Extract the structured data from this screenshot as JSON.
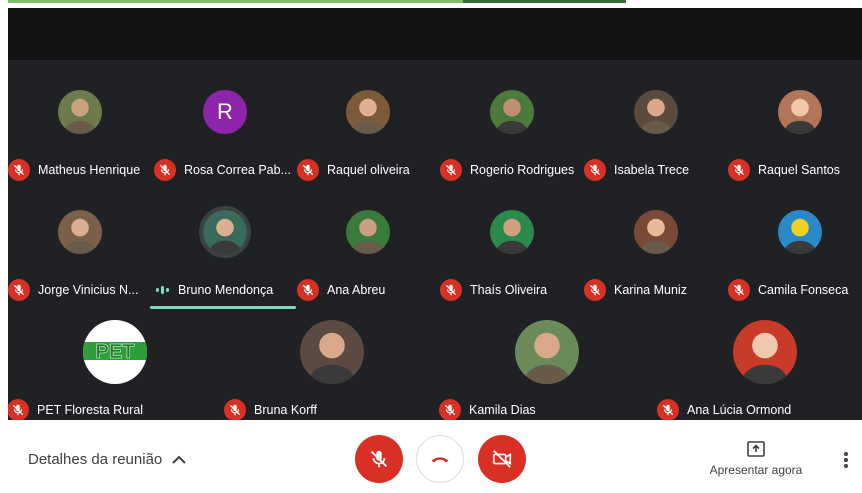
{
  "participants": [
    {
      "name": "Matheus Henrique",
      "avatar": "photo",
      "muted": true
    },
    {
      "name": "Rosa Correa Pab...",
      "avatar": "letter",
      "letter": "R",
      "avatar_color": "#8e24aa",
      "muted": true
    },
    {
      "name": "Raquel oliveira",
      "avatar": "photo",
      "muted": true
    },
    {
      "name": "Rogerio Rodrigues",
      "avatar": "photo",
      "muted": true
    },
    {
      "name": "Isabela Trece",
      "avatar": "photo",
      "muted": true
    },
    {
      "name": "Raquel Santos",
      "avatar": "photo",
      "muted": true
    },
    {
      "name": "Jorge Vinicius N...",
      "avatar": "photo",
      "muted": true
    },
    {
      "name": "Bruno Mendonça",
      "avatar": "photo",
      "muted": false,
      "speaking": true
    },
    {
      "name": "Ana Abreu",
      "avatar": "photo",
      "muted": true
    },
    {
      "name": "Thaís Oliveira",
      "avatar": "photo",
      "muted": true
    },
    {
      "name": "Karina Muniz",
      "avatar": "photo",
      "muted": true
    },
    {
      "name": "Camila Fonseca",
      "avatar": "photo",
      "muted": true
    },
    {
      "name": "PET Floresta Rural",
      "avatar": "logo",
      "logo_text": "PET",
      "muted": true
    },
    {
      "name": "Bruna Korff",
      "avatar": "photo",
      "muted": true
    },
    {
      "name": "Kamila Dias",
      "avatar": "photo",
      "muted": true
    },
    {
      "name": "Ana Lúcia Ormond",
      "avatar": "photo",
      "muted": true
    }
  ],
  "controls": {
    "meeting_details": "Detalhes da reunião",
    "present_now": "Apresentar agora",
    "mic_icon": "mic-off-icon",
    "hangup_icon": "call-end-icon",
    "camera_icon": "videocam-off-icon"
  },
  "colors": {
    "meeting_bg": "#202124",
    "muted_red": "#d93025",
    "speaking_teal": "#7fd8c4"
  }
}
